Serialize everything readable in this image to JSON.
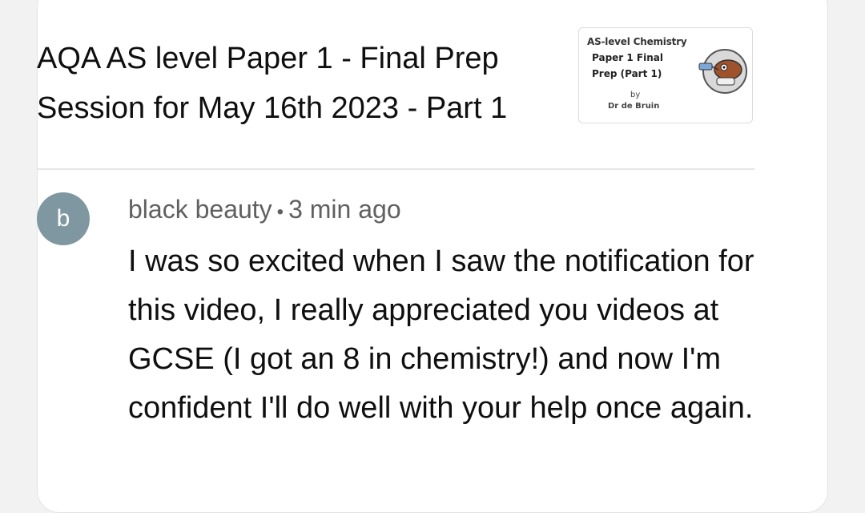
{
  "video": {
    "title": "AQA AS level Paper 1 - Final Prep Session for May 16th 2023 - Part 1",
    "thumbnail": {
      "line1": "AS-level Chemistry",
      "line2": "Paper 1 Final",
      "line3": "Prep (Part 1)",
      "line4": "by",
      "line5": "Dr de Bruin"
    }
  },
  "comment": {
    "avatar_letter": "b",
    "author": "black beauty",
    "separator": "•",
    "time": "3 min ago",
    "text": "I was so excited when I saw the notification for this video, I really appreciated you videos at GCSE (I got an 8 in chemistry!) and now I'm confident I'll do well with your help once again."
  },
  "colors": {
    "avatar_bg": "#7f97a1",
    "meta_text": "#606060",
    "primary_text": "#0f0f0f"
  }
}
